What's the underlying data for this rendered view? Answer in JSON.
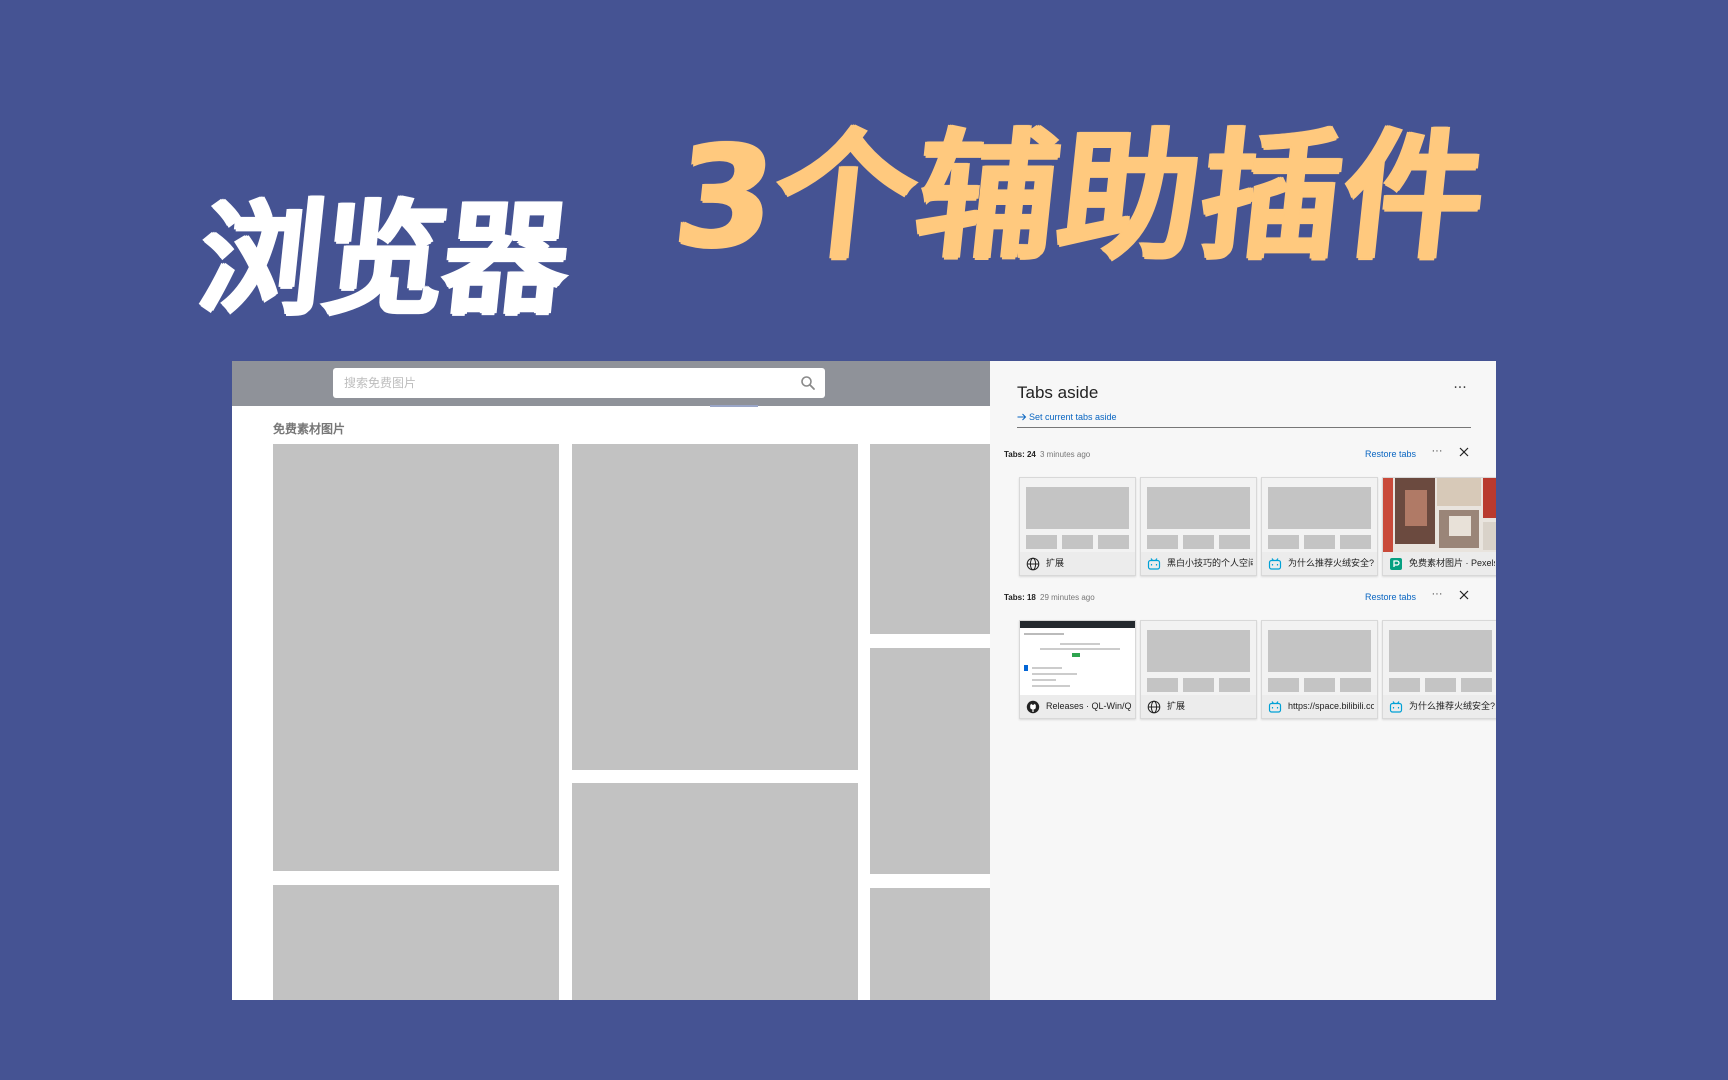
{
  "headline": {
    "left": "浏览器",
    "right": "3个辅助插件"
  },
  "browser_page": {
    "search": {
      "placeholder": "搜索免费图片"
    },
    "section_title": "免费素材图片"
  },
  "tabs_aside": {
    "title": "Tabs aside",
    "more_label": "···",
    "set_aside_label": "Set current tabs aside",
    "groups": [
      {
        "count_label": "Tabs: 24",
        "time_label": "3 minutes ago",
        "restore_label": "Restore tabs",
        "more_label": "···",
        "tabs": [
          {
            "label": "扩展",
            "icon": "globe-icon",
            "thumb": "placeholder"
          },
          {
            "label": "黑白小技巧的个人空间",
            "icon": "bilibili-icon",
            "thumb": "placeholder"
          },
          {
            "label": "为什么推荐火绒安全?",
            "icon": "bilibili-icon",
            "thumb": "placeholder"
          },
          {
            "label": "免费素材图片 · Pexels",
            "icon": "pexels-icon",
            "thumb": "photo"
          }
        ]
      },
      {
        "count_label": "Tabs: 18",
        "time_label": "29 minutes ago",
        "restore_label": "Restore tabs",
        "more_label": "···",
        "tabs": [
          {
            "label": "Releases · QL-Win/QuickLook",
            "icon": "github-icon",
            "thumb": "screenshot"
          },
          {
            "label": "扩展",
            "icon": "globe-icon",
            "thumb": "placeholder"
          },
          {
            "label": "https://space.bilibili.com",
            "icon": "bilibili-icon",
            "thumb": "placeholder"
          },
          {
            "label": "为什么推荐火绒安全?",
            "icon": "bilibili-icon",
            "thumb": "placeholder"
          }
        ]
      }
    ]
  },
  "colors": {
    "background": "#455393",
    "headline_left": "#ffffff",
    "headline_right": "#ffc97e",
    "link": "#0a66c2",
    "bilibili": "#00a1d6",
    "pexels": "#05a081"
  }
}
